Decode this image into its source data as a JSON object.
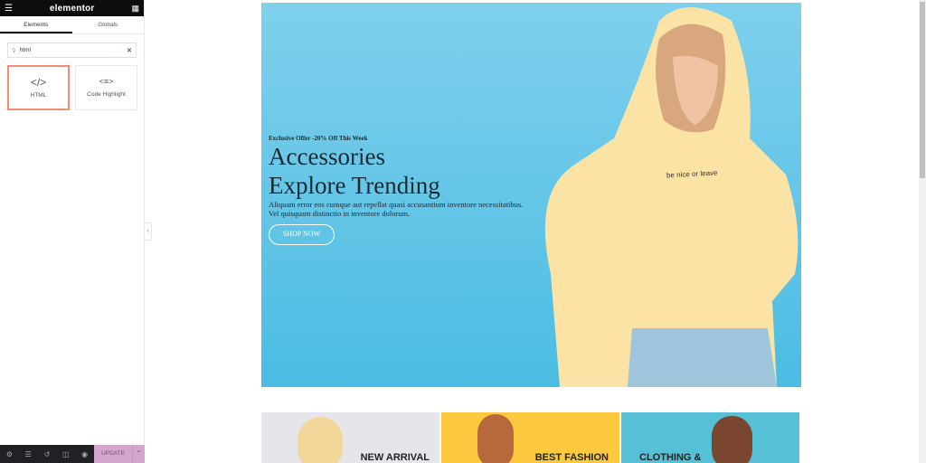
{
  "sidebar": {
    "logo": "elementor",
    "tabs": [
      {
        "label": "Elements"
      },
      {
        "label": "Globals"
      }
    ],
    "search": {
      "value": "html"
    },
    "widgets": [
      {
        "label": "HTML",
        "icon": "code-icon"
      },
      {
        "label": "Code Highlight",
        "icon": "code-highlight-icon"
      }
    ],
    "bottom": {
      "update_label": "UPDATE"
    }
  },
  "hero": {
    "offer": "Exclusive Offer -20% Off This Week",
    "title1": "Accessories",
    "title2": "Explore Trending",
    "desc1": "Aliquam error eos cumque aut repellat quasi accusantium inventore necessitatibus.",
    "desc2": "Vel quisquam distinctio in inventore dolorum.",
    "button": "SHOP NOW",
    "hoodie_text": "be nice or leave"
  },
  "cards": [
    {
      "label": "NEW ARRIVAL",
      "bg": "#e6e5ea"
    },
    {
      "label": "BEST FASHION",
      "bg": "#fcc93e"
    },
    {
      "label": "CLOTHING &",
      "bg": "#56c1d6"
    }
  ],
  "colors": {
    "accent": "#d5a6cd",
    "selected_border": "#f38b75",
    "hero_bg": "#5cc4e8"
  }
}
